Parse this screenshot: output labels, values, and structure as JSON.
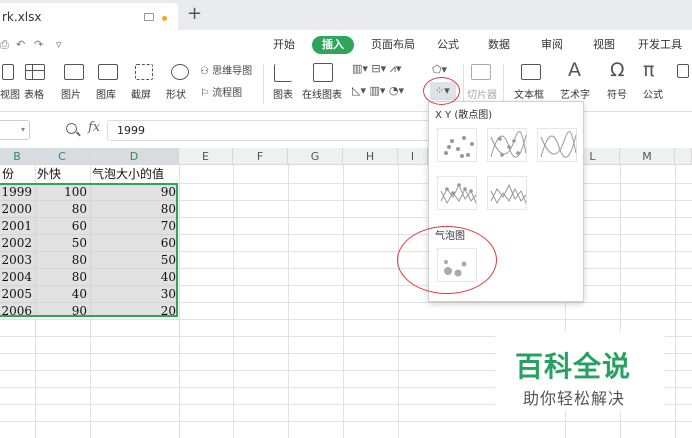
{
  "titlebar": {
    "doc_title": "rk.xlsx",
    "new_tab": "+"
  },
  "menu_tabs": [
    "开始",
    "插入",
    "页面布局",
    "公式",
    "数据",
    "审阅",
    "视图",
    "开发工具"
  ],
  "ribbon": {
    "tools": [
      "视图",
      "表格",
      "图片",
      "图库",
      "截屏",
      "形状",
      "图表",
      "在线图表",
      "切片器",
      "文本框",
      "艺术字",
      "符号",
      "公式"
    ],
    "mindmap": "思维导图",
    "flowchart": "流程图"
  },
  "formula_bar": {
    "fx": "fx",
    "value": "1999"
  },
  "columns": [
    "B",
    "C",
    "D",
    "E",
    "F",
    "G",
    "H",
    "I",
    "L",
    "M"
  ],
  "table": {
    "headers": [
      "份",
      "外快",
      "气泡大小的值"
    ],
    "rows": [
      [
        "1999",
        "100",
        "90"
      ],
      [
        "2000",
        "80",
        "80"
      ],
      [
        "2001",
        "60",
        "70"
      ],
      [
        "2002",
        "50",
        "60"
      ],
      [
        "2003",
        "80",
        "50"
      ],
      [
        "2004",
        "80",
        "40"
      ],
      [
        "2005",
        "40",
        "30"
      ],
      [
        "2006",
        "90",
        "20"
      ]
    ]
  },
  "chart_dropdown": {
    "xy_title": "X Y (散点图)",
    "bubble_title": "气泡图"
  },
  "watermark": {
    "title": "百科全说",
    "subtitle": "助你轻松解决"
  },
  "colors": {
    "accent": "#2ea65a",
    "highlight_circle": "#e03a3a"
  }
}
